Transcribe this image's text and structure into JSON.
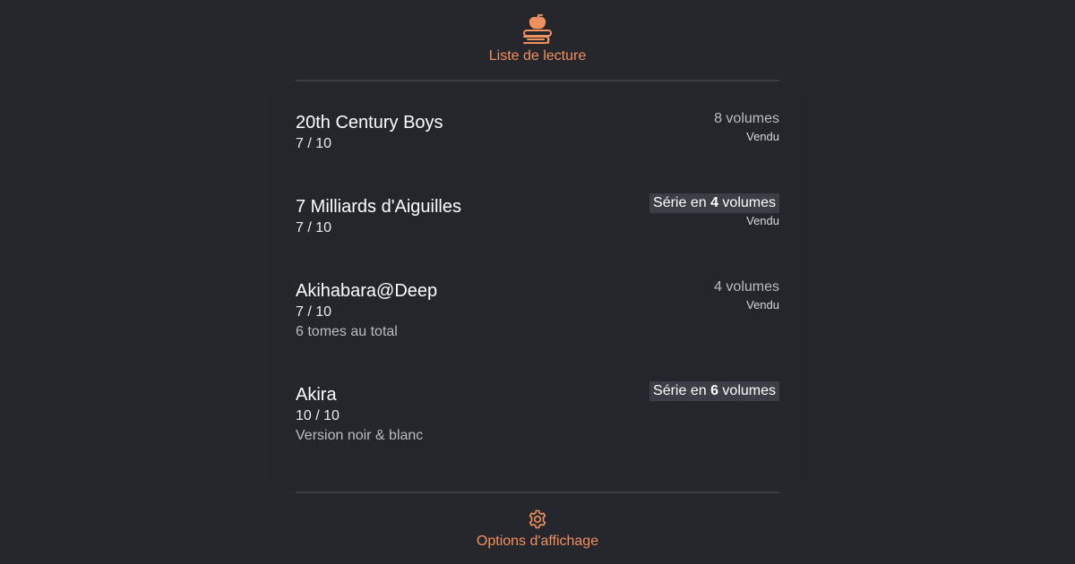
{
  "header": {
    "icon": "books-apple-icon",
    "label": "Liste de lecture"
  },
  "items": [
    {
      "title": "20th Century Boys",
      "rating": "7 / 10",
      "volumes": "8 volumes",
      "status": "Vendu"
    },
    {
      "title": "7 Milliards d'Aiguilles",
      "rating": "7 / 10",
      "series_prefix": "Série en",
      "series_count": "4",
      "series_suffix": "volumes",
      "status": "Vendu"
    },
    {
      "title": "Akihabara@Deep",
      "rating": "7 / 10",
      "note": "6 tomes au total",
      "volumes": "4 volumes",
      "status": "Vendu"
    },
    {
      "title": "Akira",
      "rating": "10 / 10",
      "note": "Version noir & blanc",
      "series_prefix": "Série en",
      "series_count": "6",
      "series_suffix": "volumes"
    }
  ],
  "footer": {
    "icon": "gear-icon",
    "label": "Options d'affichage"
  },
  "colors": {
    "background": "#25272d",
    "accent": "#f0915e",
    "badge": "#3b3e45"
  }
}
